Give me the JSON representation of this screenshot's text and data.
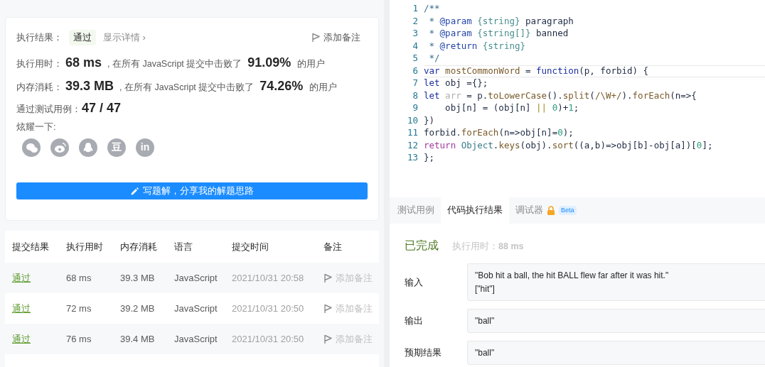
{
  "result_card": {
    "result_label": "执行结果：",
    "result_badge": "通过",
    "details_link": "显示详情 ›",
    "add_note": "添加备注",
    "stats": [
      {
        "label": "执行用时：",
        "value": "68 ms",
        "text": ", 在所有 JavaScript 提交中击败了",
        "percent": "91.09%",
        "suffix": "的用户"
      },
      {
        "label": "内存消耗：",
        "value": "39.3 MB",
        "text": ", 在所有 JavaScript 提交中击败了",
        "percent": "74.26%",
        "suffix": "的用户"
      }
    ],
    "tests_label": "通过测试用例：",
    "tests_value": "47 / 47",
    "share_label": "炫耀一下:",
    "share": [
      {
        "kind": "chat"
      },
      {
        "kind": "swirl"
      },
      {
        "kind": "penguin"
      },
      {
        "kind": "text",
        "text": "豆"
      },
      {
        "kind": "text",
        "text": "in"
      }
    ],
    "write_button": "写题解，分享我的解题思路"
  },
  "submissions": {
    "columns": [
      "提交结果",
      "执行用时",
      "内存消耗",
      "语言",
      "提交时间",
      "备注"
    ],
    "rows": [
      {
        "status": "通过",
        "time": "68 ms",
        "memory": "39.3 MB",
        "language": "JavaScript",
        "submitted": "2021/10/31 20:58",
        "note": "添加备注"
      },
      {
        "status": "通过",
        "time": "72 ms",
        "memory": "39.2 MB",
        "language": "JavaScript",
        "submitted": "2021/10/31 20:50",
        "note": "添加备注"
      },
      {
        "status": "通过",
        "time": "76 ms",
        "memory": "39.4 MB",
        "language": "JavaScript",
        "submitted": "2021/10/31 20:50",
        "note": "添加备注"
      }
    ]
  },
  "editor": {
    "lines": [
      {
        "number": "1",
        "current": false,
        "tokens": [
          {
            "kind": "comment",
            "text": "/**"
          }
        ]
      },
      {
        "number": "2",
        "current": false,
        "tokens": [
          {
            "kind": "comment",
            "text": " * "
          },
          {
            "kind": "tag",
            "text": "@param"
          },
          {
            "kind": "type",
            "text": " {string}"
          },
          {
            "kind": "plain",
            "text": " paragraph"
          }
        ]
      },
      {
        "number": "3",
        "current": false,
        "tokens": [
          {
            "kind": "comment",
            "text": " * "
          },
          {
            "kind": "tag",
            "text": "@param"
          },
          {
            "kind": "type",
            "text": " {string[]}"
          },
          {
            "kind": "plain",
            "text": " banned"
          }
        ]
      },
      {
        "number": "4",
        "current": false,
        "tokens": [
          {
            "kind": "comment",
            "text": " * "
          },
          {
            "kind": "tag",
            "text": "@return"
          },
          {
            "kind": "type",
            "text": " {string}"
          }
        ]
      },
      {
        "number": "5",
        "current": false,
        "tokens": [
          {
            "kind": "comment",
            "text": " */"
          }
        ]
      },
      {
        "number": "6",
        "current": true,
        "tokens": [
          {
            "kind": "keyword",
            "text": "var"
          },
          {
            "kind": "func",
            "text": " mostCommonWord"
          },
          {
            "kind": "plain",
            "text": " = "
          },
          {
            "kind": "keyword",
            "text": "function"
          },
          {
            "kind": "plain",
            "text": "(p, forbid) {"
          }
        ]
      },
      {
        "number": "7",
        "current": false,
        "tokens": [
          {
            "kind": "keyword",
            "text": "let"
          },
          {
            "kind": "plain",
            "text": " obj ={};"
          }
        ]
      },
      {
        "number": "8",
        "current": false,
        "tokens": [
          {
            "kind": "keyword",
            "text": "let"
          },
          {
            "kind": "unused",
            "text": " arr"
          },
          {
            "kind": "plain",
            "text": " = p."
          },
          {
            "kind": "func",
            "text": "toLowerCase"
          },
          {
            "kind": "plain",
            "text": "()."
          },
          {
            "kind": "func",
            "text": "split"
          },
          {
            "kind": "plain",
            "text": "("
          },
          {
            "kind": "regex",
            "text": "/\\W+/"
          },
          {
            "kind": "plain",
            "text": ")."
          },
          {
            "kind": "func",
            "text": "forEach"
          },
          {
            "kind": "plain",
            "text": "(n=>{"
          }
        ]
      },
      {
        "number": "9",
        "current": false,
        "tokens": [
          {
            "kind": "plain",
            "text": "    obj[n] = (obj[n] "
          },
          {
            "kind": "operator",
            "text": "||"
          },
          {
            "kind": "number",
            "text": " 0"
          },
          {
            "kind": "plain",
            "text": ")+"
          },
          {
            "kind": "number",
            "text": "1"
          },
          {
            "kind": "plain",
            "text": ";"
          }
        ]
      },
      {
        "number": "10",
        "current": false,
        "tokens": [
          {
            "kind": "plain",
            "text": "})"
          }
        ]
      },
      {
        "number": "11",
        "current": false,
        "tokens": [
          {
            "kind": "plain",
            "text": "forbid."
          },
          {
            "kind": "func",
            "text": "forEach"
          },
          {
            "kind": "plain",
            "text": "(n=>obj[n]="
          },
          {
            "kind": "number",
            "text": "0"
          },
          {
            "kind": "plain",
            "text": ");"
          }
        ]
      },
      {
        "number": "12",
        "current": false,
        "tokens": [
          {
            "kind": "control",
            "text": "return"
          },
          {
            "kind": "class",
            "text": " Object"
          },
          {
            "kind": "plain",
            "text": "."
          },
          {
            "kind": "func",
            "text": "keys"
          },
          {
            "kind": "plain",
            "text": "(obj)."
          },
          {
            "kind": "func",
            "text": "sort"
          },
          {
            "kind": "plain",
            "text": "((a,b)=>obj[b]-obj[a])["
          },
          {
            "kind": "number",
            "text": "0"
          },
          {
            "kind": "plain",
            "text": "];"
          }
        ]
      },
      {
        "number": "13",
        "current": false,
        "tokens": [
          {
            "kind": "plain",
            "text": "};"
          }
        ]
      }
    ]
  },
  "console": {
    "tabs": [
      {
        "label": "测试用例",
        "selected": false,
        "locked": false
      },
      {
        "label": "代码执行结果",
        "selected": true,
        "locked": false
      },
      {
        "label": "调试器",
        "selected": false,
        "locked": true,
        "badge": "Beta"
      }
    ],
    "status": "已完成",
    "runtime_label": "执行用时：",
    "runtime_value": "88 ms",
    "rows": [
      {
        "label": "输入",
        "lines": [
          "\"Bob hit a ball, the hit BALL flew far after it was hit.\"",
          "[\"hit\"]"
        ]
      },
      {
        "label": "输出",
        "lines": [
          "\"ball\""
        ]
      },
      {
        "label": "预期结果",
        "lines": [
          "\"ball\""
        ]
      }
    ]
  }
}
